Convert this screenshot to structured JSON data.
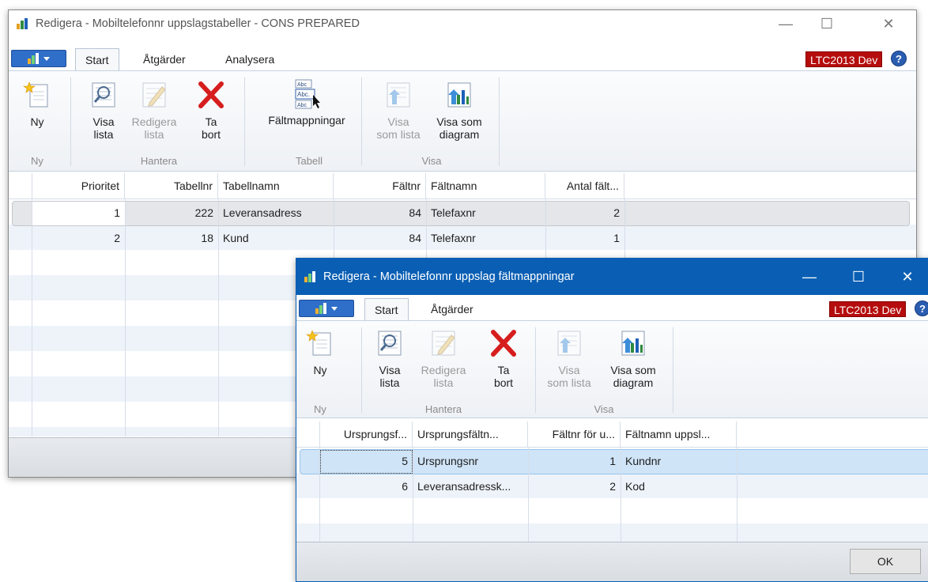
{
  "window1": {
    "title": "Redigera - Mobiltelefonnr uppslagstabeller - CONS PREPARED",
    "tabs": [
      "Start",
      "Åtgärder",
      "Analysera"
    ],
    "env_badge": "LTC2013 Dev",
    "help": "?",
    "ribbon": {
      "new_line1": "Ny",
      "view_list_1": "Visa",
      "view_list_2": "lista",
      "edit_list_1": "Redigera",
      "edit_list_2": "lista",
      "delete_1": "Ta",
      "delete_2": "bort",
      "field_mappings": "Fältmappningar",
      "as_list_1": "Visa",
      "as_list_2": "som lista",
      "as_chart_1": "Visa som",
      "as_chart_2": "diagram",
      "group_new": "Ny",
      "group_manage": "Hantera",
      "group_table": "Tabell",
      "group_view": "Visa"
    },
    "columns": [
      "Prioritet",
      "Tabellnr",
      "Tabellnamn",
      "Fältnr",
      "Fältnamn",
      "Antal fält..."
    ],
    "rows": [
      {
        "prioritet": "1",
        "tabellnr": "222",
        "tabellnamn": "Leveransadress",
        "faltnr": "84",
        "faltnamn": "Telefaxnr",
        "antal": "2"
      },
      {
        "prioritet": "2",
        "tabellnr": "18",
        "tabellnamn": "Kund",
        "faltnr": "84",
        "faltnamn": "Telefaxnr",
        "antal": "1"
      }
    ]
  },
  "window2": {
    "title": "Redigera - Mobiltelefonnr uppslag fältmappningar",
    "tabs": [
      "Start",
      "Åtgärder"
    ],
    "env_badge": "LTC2013 Dev",
    "help": "?",
    "ribbon": {
      "new_line1": "Ny",
      "view_list_1": "Visa",
      "view_list_2": "lista",
      "edit_list_1": "Redigera",
      "edit_list_2": "lista",
      "delete_1": "Ta",
      "delete_2": "bort",
      "as_list_1": "Visa",
      "as_list_2": "som lista",
      "as_chart_1": "Visa som",
      "as_chart_2": "diagram",
      "group_new": "Ny",
      "group_manage": "Hantera",
      "group_view": "Visa"
    },
    "columns": [
      "Ursprungsf...",
      "Ursprungsfältn...",
      "Fältnr för u...",
      "Fältnamn uppsl..."
    ],
    "rows": [
      {
        "c1": "5",
        "c2": "Ursprungsnr",
        "c3": "1",
        "c4": "Kundnr"
      },
      {
        "c1": "6",
        "c2": "Leveransadressk...",
        "c3": "2",
        "c4": "Kod"
      }
    ],
    "ok_label": "OK"
  },
  "colors": {
    "accent": "#0a5fb4",
    "badge": "#b50d0d",
    "selected_row": "#cfe4f7",
    "alt_row": "#eef3fa"
  }
}
